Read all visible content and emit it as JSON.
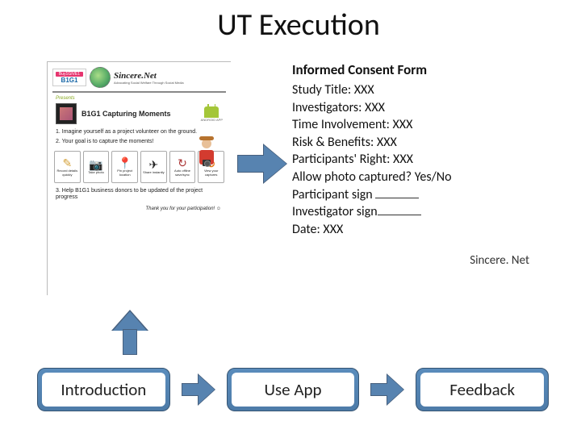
{
  "title": "UT Execution",
  "intro": {
    "b1g1_top": "Buy1GIVE1",
    "b1g1": "B1G1",
    "sincere": "Sincere.Net",
    "sincere_sub": "Advocating Social Welfare Through Social Media",
    "presents": "Presents",
    "app_title": "B1G1 Capturing Moments",
    "android": "ANDROID APP",
    "li1": "1. Imagine yourself as a project volunteer on the ground.",
    "li2": "2. Your goal is to capture the moments!",
    "li3": "3. Help B1G1 business donors to be updated of the project progress",
    "thanks": "Thank you for your participation! ☺",
    "icons": [
      {
        "glyph": "✎",
        "color": "#d4a13a",
        "label": "Record details quickly"
      },
      {
        "glyph": "📷",
        "color": "#333",
        "label": "Take photo"
      },
      {
        "glyph": "📍",
        "color": "#333",
        "label": "Pin project location"
      },
      {
        "glyph": "✈",
        "color": "#333",
        "label": "Share instantly"
      },
      {
        "glyph": "⎘",
        "color": "#a33",
        "label": "Auto offline save/sync"
      },
      {
        "glyph": "📶",
        "color": "#e57f22",
        "label": "View your captures"
      }
    ]
  },
  "consent": {
    "heading": "Informed Consent Form",
    "lines": [
      "Study Title: XXX",
      "Investigators: XXX",
      "Time Involvement: XXX",
      "Risk & Benefits: XXX",
      "Participants' Right: XXX",
      "Allow photo captured? Yes/No"
    ],
    "participant_sign": "Participant sign ",
    "investigator_sign": "Investigator sign",
    "date": "Date: XXX",
    "footer": "Sincere. Net"
  },
  "flow": {
    "step1": "Introduction",
    "step2": "Use App",
    "step3": "Feedback"
  }
}
